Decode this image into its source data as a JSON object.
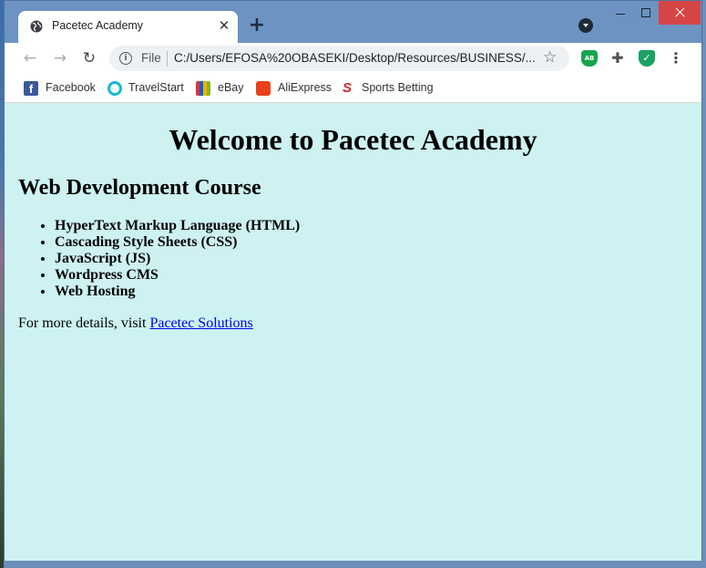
{
  "browser": {
    "tab_title": "Pacetec Academy",
    "tab_close": "✕",
    "new_tab": "+",
    "address_scheme": "File",
    "address_url": "C:/Users/EFOSA%20OBASEKI/Desktop/Resources/BUSINESS/...",
    "extension_ab_label": "AB",
    "bookmarks": [
      {
        "label": "Facebook",
        "icon": "facebook-icon"
      },
      {
        "label": "TravelStart",
        "icon": "travelstart-icon"
      },
      {
        "label": "eBay",
        "icon": "ebay-icon"
      },
      {
        "label": "AliExpress",
        "icon": "aliexpress-icon"
      },
      {
        "label": "Sports Betting",
        "icon": "sports-betting-icon"
      }
    ]
  },
  "page": {
    "heading": "Welcome to Pacetec Academy",
    "subheading": "Web Development Course",
    "course_items": [
      "HyperText Markup Language (HTML)",
      "Cascading Style Sheets (CSS)",
      "JavaScript (JS)",
      "Wordpress CMS",
      "Web Hosting"
    ],
    "details_prefix": "For more details, visit ",
    "details_link": "Pacetec Solutions",
    "background_color": "#cdf2f1",
    "link_color": "#0000ee"
  }
}
